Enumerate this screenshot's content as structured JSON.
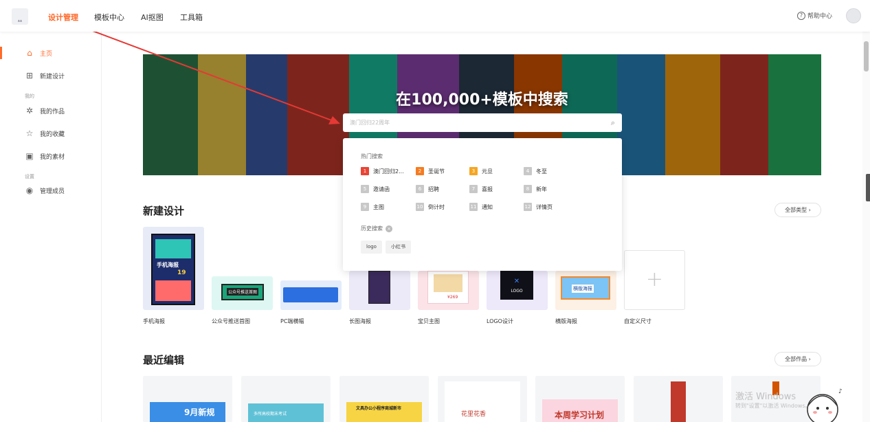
{
  "header": {
    "nav": [
      "设计管理",
      "模板中心",
      "AI抠图",
      "工具箱"
    ],
    "help": "帮助中心"
  },
  "sidebar": {
    "home": "主页",
    "new_design": "新建设计",
    "group_mine": "我的",
    "works": "我的作品",
    "favorites": "我的收藏",
    "materials": "我的素材",
    "group_settings": "设置",
    "members": "管理成员"
  },
  "banner": {
    "title": "在100,000+模板中搜索",
    "search_placeholder": "澳门回归22周年"
  },
  "dropdown": {
    "hot_label": "热门搜索",
    "hot": [
      {
        "rank": "1",
        "text": "澳门回归2...",
        "color": "#e94434"
      },
      {
        "rank": "2",
        "text": "圣诞节",
        "color": "#f57c22"
      },
      {
        "rank": "3",
        "text": "元旦",
        "color": "#f5a623"
      },
      {
        "rank": "4",
        "text": "冬至",
        "color": "#c8c8c8"
      },
      {
        "rank": "5",
        "text": "邀请函",
        "color": "#c8c8c8"
      },
      {
        "rank": "6",
        "text": "招聘",
        "color": "#c8c8c8"
      },
      {
        "rank": "7",
        "text": "喜报",
        "color": "#c8c8c8"
      },
      {
        "rank": "8",
        "text": "新年",
        "color": "#c8c8c8"
      },
      {
        "rank": "9",
        "text": "主图",
        "color": "#c8c8c8"
      },
      {
        "rank": "10",
        "text": "倒计时",
        "color": "#c8c8c8"
      },
      {
        "rank": "11",
        "text": "通知",
        "color": "#c8c8c8"
      },
      {
        "rank": "12",
        "text": "详情页",
        "color": "#c8c8c8"
      }
    ],
    "history_label": "历史搜索",
    "history": [
      "logo",
      "小红书"
    ]
  },
  "new_design": {
    "title": "新建设计",
    "all_types": "全部类型 ›",
    "items": [
      "手机海报",
      "公众号推送首图",
      "PC端横幅",
      "长图海报",
      "宝贝主图",
      "LOGO设计",
      "横版海报",
      "自定义尺寸"
    ]
  },
  "thumbs": {
    "poster_title": "手机海报",
    "poster_num": "19",
    "wechat_text": "公众号推送首图",
    "logo_text": "LOGO",
    "landscape_text": "横版海报",
    "price_text": "¥269"
  },
  "recent": {
    "title": "最近编辑",
    "all_works": "全部作品 ›",
    "cards": [
      "9月新规",
      "多所高校期末考试",
      "文具办公小程序商城新市",
      "花里花香",
      "本周学习计划",
      "",
      ""
    ]
  },
  "os": {
    "activate_title": "激活 Windows",
    "activate_sub": "转到\"设置\"以激活 Windows。"
  },
  "colors": {
    "accent": "#ff6a2b"
  }
}
